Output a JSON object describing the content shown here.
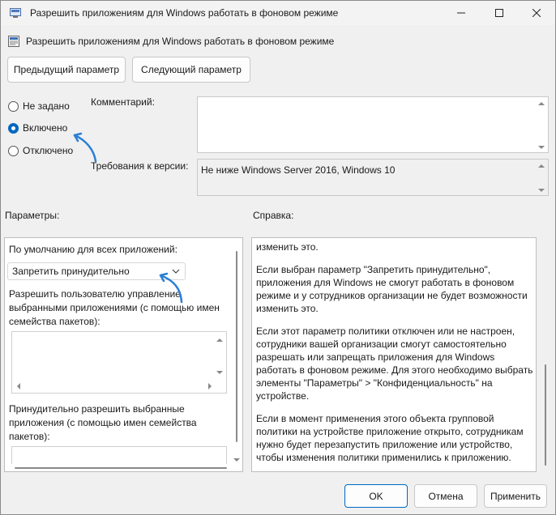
{
  "window": {
    "title": "Разрешить приложениям для Windows работать в фоновом режиме",
    "controls": [
      "minimize",
      "maximize",
      "close"
    ]
  },
  "header": {
    "policy_name": "Разрешить приложениям для Windows работать в фоновом режиме"
  },
  "nav": {
    "prev_label": "Предыдущий параметр",
    "next_label": "Следующий параметр"
  },
  "state": {
    "options": [
      {
        "label": "Не задано",
        "selected": false
      },
      {
        "label": "Включено",
        "selected": true
      },
      {
        "label": "Отключено",
        "selected": false
      }
    ]
  },
  "comment": {
    "label": "Комментарий:",
    "value": ""
  },
  "requirements": {
    "label": "Требования к версии:",
    "value": "Не ниже Windows Server 2016, Windows 10"
  },
  "params": {
    "section_label": "Параметры:",
    "default_label": "По умолчанию для всех приложений:",
    "default_select": "Запретить принудительно",
    "allow_user_label_lines": [
      "Разрешить пользователю управление",
      "выбранными приложениями (с помощью имен",
      "семейства пакетов):"
    ],
    "force_allow_label_lines": [
      "Принудительно разрешить выбранные",
      "приложения (с помощью имен семейства",
      "пакетов):"
    ]
  },
  "help": {
    "section_label": "Справка:",
    "lines": [
      "изменить это.",
      "",
      "Если выбран параметр \"Запретить принудительно\",",
      "приложения для Windows не смогут работать в фоновом",
      "режиме и у сотрудников организации не будет возможности",
      "изменить это.",
      "",
      "Если этот параметр политики отключен или не настроен,",
      "сотрудники вашей организации смогут самостоятельно",
      "разрешать или запрещать приложения для Windows",
      "работать в фоновом режиме. Для этого необходимо выбрать",
      "элементы \"Параметры\" > \"Конфиденциальность\" на",
      "устройстве.",
      "",
      "Если в момент применения этого объекта групповой",
      "политики на устройстве приложение открыто, сотрудникам",
      "нужно будет перезапустить приложение или устройство,",
      "чтобы изменения политики применились к приложению."
    ]
  },
  "footer": {
    "ok_label": "OK",
    "cancel_label": "Отмена",
    "apply_label": "Применить"
  },
  "colors": {
    "accent": "#0067c0",
    "annotation_arrow": "#2a7fd4"
  }
}
